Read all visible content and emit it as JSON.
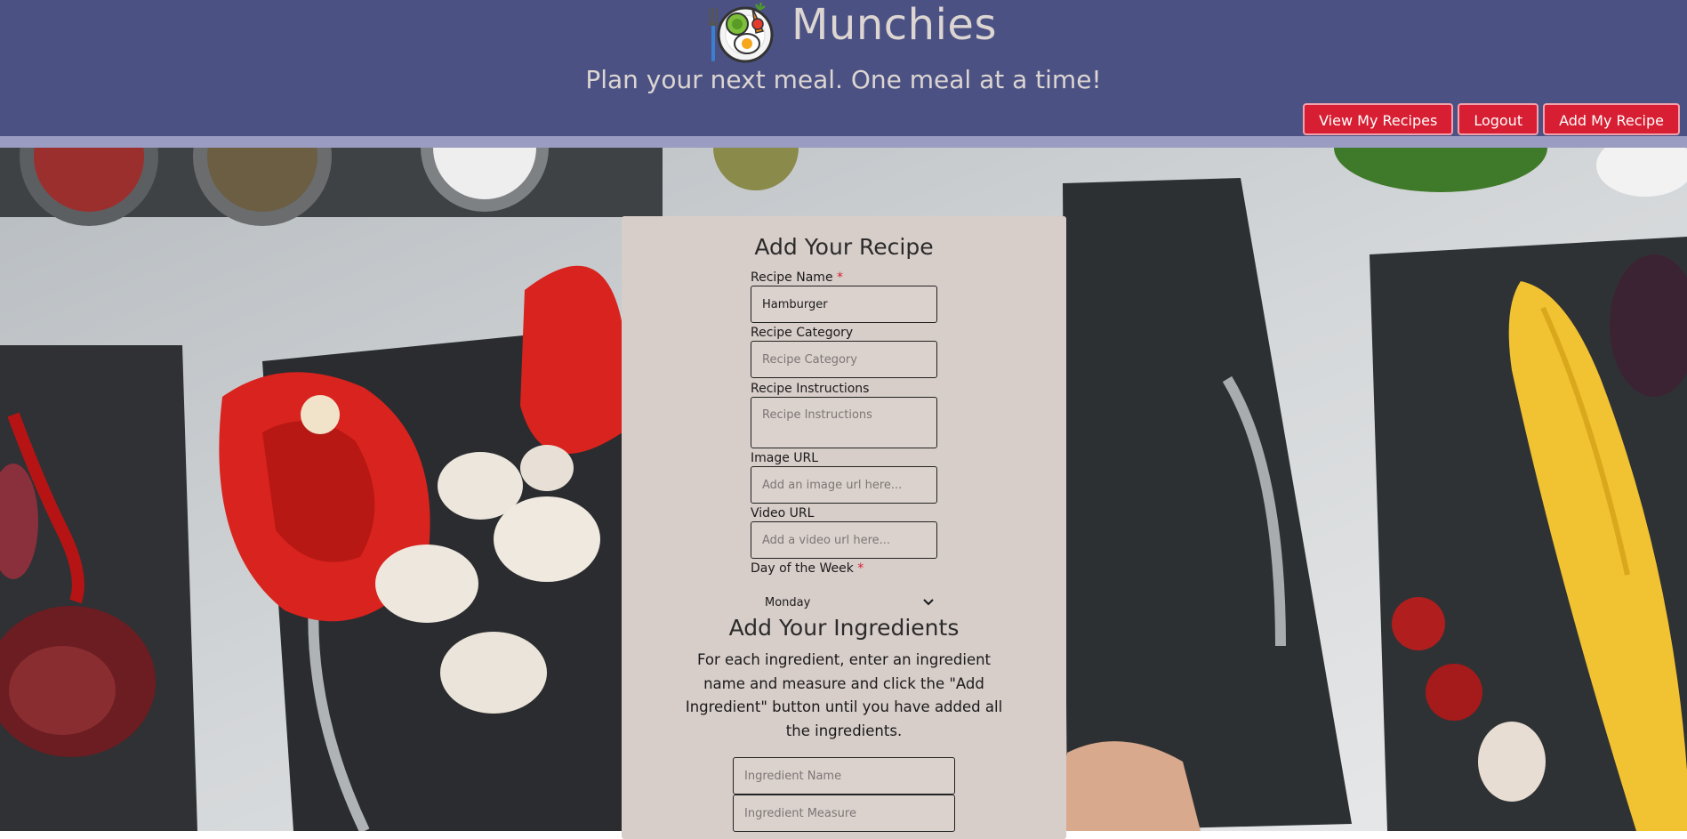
{
  "header": {
    "brand_name": "Munchies",
    "tagline": "Plan your next meal. One meal at a time!",
    "nav": {
      "view_recipes": "View My Recipes",
      "logout": "Logout",
      "add_recipe": "Add My Recipe"
    }
  },
  "colors": {
    "header_bg": "#4b5283",
    "button_bg": "#d81e32",
    "card_bg": "#d7cdc9"
  },
  "form": {
    "title": "Add Your Recipe",
    "recipe_name": {
      "label": "Recipe Name",
      "required_mark": "*",
      "value": "Hamburger"
    },
    "recipe_category": {
      "label": "Recipe Category",
      "placeholder": "Recipe Category"
    },
    "recipe_instructions": {
      "label": "Recipe Instructions",
      "placeholder": "Recipe Instructions"
    },
    "image_url": {
      "label": "Image URL",
      "placeholder": "Add an image url here..."
    },
    "video_url": {
      "label": "Video URL",
      "placeholder": "Add a video url here..."
    },
    "day_of_week": {
      "label": "Day of the Week",
      "required_mark": "*",
      "selected": "Monday"
    }
  },
  "ingredients": {
    "title": "Add Your Ingredients",
    "instructions": "For each ingredient, enter an ingredient name and measure and click the \"Add Ingredient\" button until you have added all the ingredients.",
    "name_placeholder": "Ingredient Name",
    "measure_placeholder": "Ingredient Measure"
  }
}
